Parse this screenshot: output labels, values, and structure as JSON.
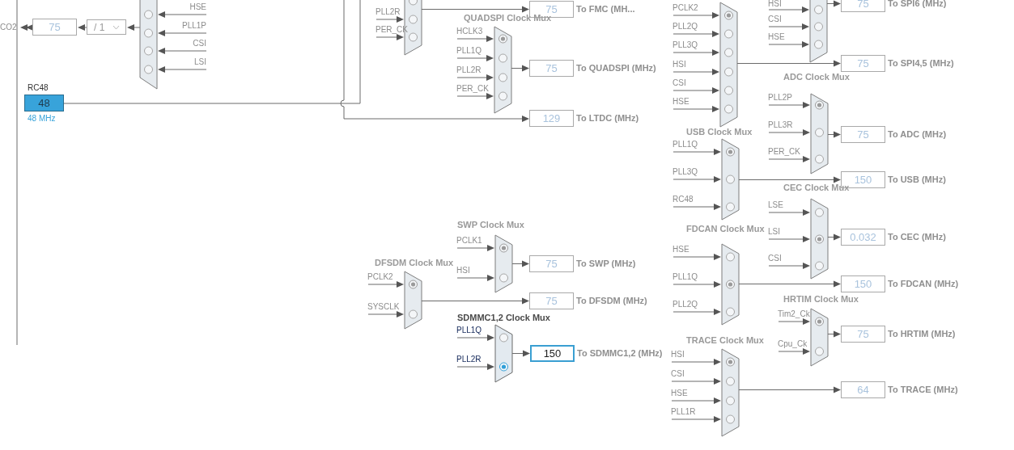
{
  "mco2": {
    "label": "CO2",
    "value": "75",
    "divider": "/ 1"
  },
  "rc48": {
    "label": "RC48",
    "value": "48",
    "frequency": "48 MHz"
  },
  "ltdc": {
    "value": "129",
    "label": "To LTDC (MHz)"
  },
  "muxes": [
    {
      "active": false,
      "inputs": [
        {
          "label": "HSE",
          "selected": false
        },
        {
          "label": "PLL1P",
          "selected": false
        },
        {
          "label": "CSI",
          "selected": false
        },
        {
          "label": "LSI",
          "selected": false
        }
      ]
    },
    {
      "active": false,
      "inputs": [
        {
          "selected": false
        },
        {
          "label": "PLL2R",
          "selected": false
        },
        {
          "label": "PER_CK",
          "selected": false
        }
      ],
      "output": {
        "value": "75",
        "label": "To FMC (MH..."
      }
    },
    {
      "title": "QUADSPI Clock Mux",
      "active": false,
      "inputs": [
        {
          "label": "HCLK3",
          "selected": true
        },
        {
          "label": "PLL1Q",
          "selected": false
        },
        {
          "label": "PLL2R",
          "selected": false
        },
        {
          "label": "PER_CK",
          "selected": false
        }
      ],
      "output": {
        "value": "75",
        "label": "To QUADSPI (MHz)"
      }
    },
    {
      "active": false,
      "inputs": [
        {
          "label": "PCLK2",
          "selected": true
        },
        {
          "label": "PLL2Q",
          "selected": false
        },
        {
          "label": "PLL3Q",
          "selected": false
        },
        {
          "label": "HSI",
          "selected": false
        },
        {
          "label": "CSI",
          "selected": false
        },
        {
          "label": "HSE",
          "selected": false
        }
      ],
      "output": {
        "value": "75",
        "label": "To SPI4,5 (MHz)"
      }
    },
    {
      "active": false,
      "inputs": [
        {
          "label": "HSI",
          "selected": false
        },
        {
          "label": "CSI",
          "selected": false
        },
        {
          "label": "HSE",
          "selected": false
        }
      ],
      "output": {
        "value": "75",
        "label": "To SPI6 (MHz)"
      }
    },
    {
      "title": "ADC Clock Mux",
      "active": false,
      "inputs": [
        {
          "label": "PLL2P",
          "selected": true
        },
        {
          "label": "PLL3R",
          "selected": false
        },
        {
          "label": "PER_CK",
          "selected": false
        }
      ],
      "output": {
        "value": "75",
        "label": "To ADC (MHz)"
      }
    },
    {
      "title": "USB Clock Mux",
      "active": false,
      "inputs": [
        {
          "label": "PLL1Q",
          "selected": true
        },
        {
          "label": "PLL3Q",
          "selected": false
        },
        {
          "label": "RC48",
          "selected": false
        }
      ],
      "output": {
        "value": "150",
        "label": "To USB (MHz)"
      }
    },
    {
      "title": "CEC Clock Mux",
      "active": false,
      "inputs": [
        {
          "label": "LSE",
          "selected": false
        },
        {
          "label": "LSI",
          "selected": true
        },
        {
          "label": "CSI",
          "selected": false
        }
      ],
      "output": {
        "value": "0.032",
        "label": "To CEC (MHz)"
      }
    },
    {
      "title": "FDCAN Clock Mux",
      "active": false,
      "inputs": [
        {
          "label": "HSE",
          "selected": false
        },
        {
          "label": "PLL1Q",
          "selected": true
        },
        {
          "label": "PLL2Q",
          "selected": false
        }
      ],
      "output": {
        "value": "150",
        "label": "To FDCAN (MHz)"
      }
    },
    {
      "title": "HRTIM Clock Mux",
      "active": false,
      "inputs": [
        {
          "label": "Tim2_Ck",
          "selected": true
        },
        {
          "label": "Cpu_Ck",
          "selected": false
        }
      ],
      "output": {
        "value": "75",
        "label": "To HRTIM (MHz)"
      }
    },
    {
      "title": "TRACE Clock Mux",
      "active": false,
      "inputs": [
        {
          "label": "HSI",
          "selected": true
        },
        {
          "label": "CSI",
          "selected": false
        },
        {
          "label": "HSE",
          "selected": false
        },
        {
          "label": "PLL1R",
          "selected": false
        }
      ],
      "output": {
        "value": "64",
        "label": "To TRACE (MHz)"
      }
    },
    {
      "title": "SWP Clock Mux",
      "active": false,
      "inputs": [
        {
          "label": "PCLK1",
          "selected": true
        },
        {
          "label": "HSI",
          "selected": false
        }
      ],
      "output": {
        "value": "75",
        "label": "To SWP (MHz)"
      }
    },
    {
      "title": "DFSDM Clock Mux",
      "active": false,
      "inputs": [
        {
          "label": "PCLK2",
          "selected": true
        },
        {
          "label": "SYSCLK",
          "selected": false
        }
      ],
      "output": {
        "value": "75",
        "label": "To DFSDM (MHz)"
      }
    },
    {
      "title": "SDMMC1,2 Clock Mux",
      "active": true,
      "inputs": [
        {
          "label": "PLL1Q",
          "selected": false
        },
        {
          "label": "PLL2R",
          "selected": true
        }
      ],
      "output": {
        "value": "150",
        "label": "To SDMMC1,2 (MHz)"
      }
    }
  ]
}
